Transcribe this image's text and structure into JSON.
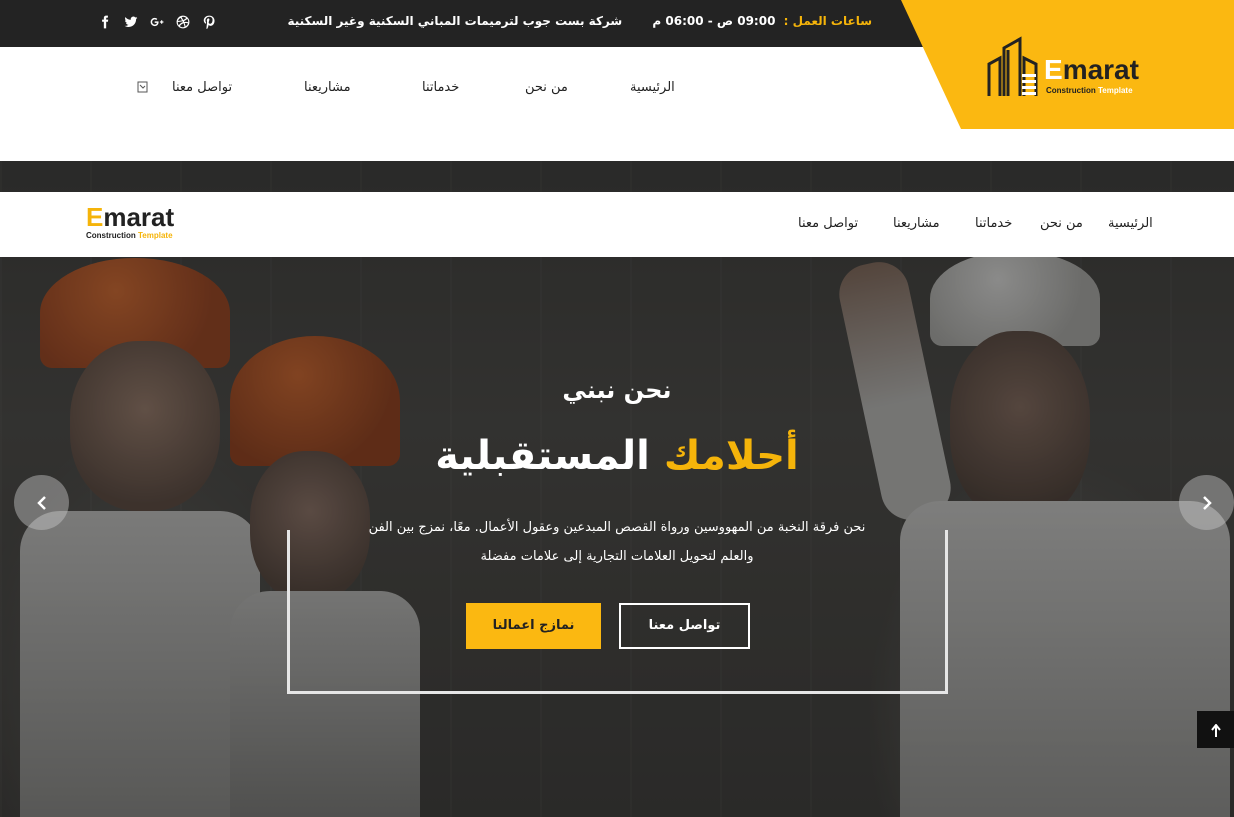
{
  "topbar": {
    "social_icons": [
      "facebook-icon",
      "twitter-icon",
      "google-plus-icon",
      "dribbble-icon",
      "pinterest-icon"
    ],
    "hours_label": "ساعات العمل :",
    "hours_value": "09:00 ص - 06:00 م",
    "tagline": "شركة بست جوب لترميمات المباني السكنية وغير السكنية"
  },
  "brand": {
    "name_first": "E",
    "name_rest": "marat",
    "sub_first": "Construction",
    "sub_second": "Template",
    "accent_color": "#fbb811"
  },
  "nav": {
    "items": [
      "الرئيسية",
      "من نحن",
      "خدماتنا",
      "مشاريعنا",
      "تواصل معنا"
    ]
  },
  "hero": {
    "kicker": "نحن نبني",
    "headline_highlight": "أحلامك",
    "headline_rest": "المستقبلية",
    "desc_line1": "نحن فرقة النخبة من المهووسين ورواة القصص المبدعين وعقول الأعمال. معًا، نمزج بين الفن",
    "desc_line2": "والعلم لتحويل العلامات التجارية إلى علامات مفضلة",
    "btn_primary": "نمازج اعمالنا",
    "btn_secondary": "تواصل معنا",
    "prev_icon": "chevron-left-icon",
    "next_icon": "chevron-right-icon",
    "scroll_top_icon": "arrow-up-icon"
  }
}
